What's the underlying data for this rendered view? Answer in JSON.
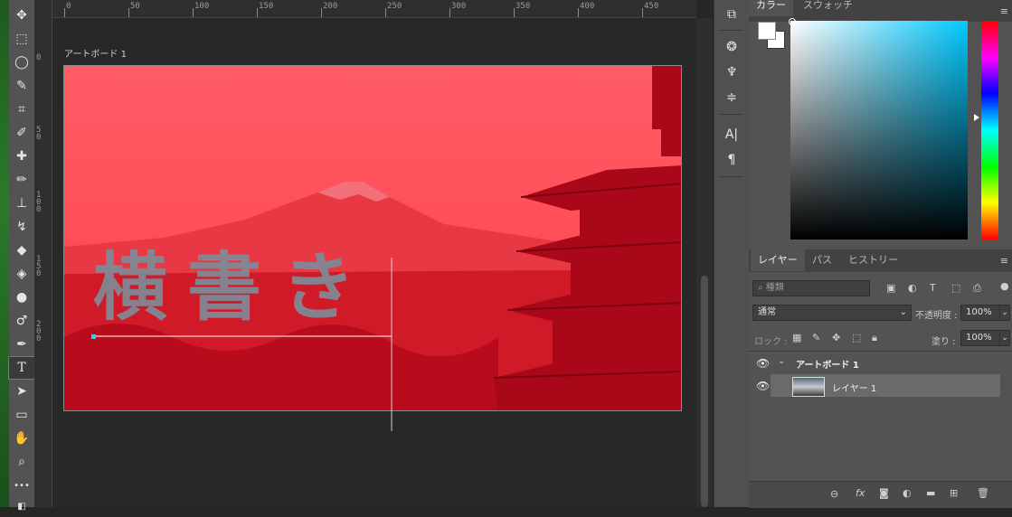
{
  "ruler": {
    "h_labels": [
      "0",
      "50",
      "100",
      "150",
      "200",
      "250",
      "300",
      "350",
      "400",
      "450"
    ],
    "v_labels": [
      "0",
      "50",
      "100",
      "150",
      "200"
    ]
  },
  "tools": [
    {
      "name": "move-tool-icon",
      "glyph": "✥"
    },
    {
      "name": "marquee-tool-icon",
      "glyph": "⬚"
    },
    {
      "name": "lasso-tool-icon",
      "glyph": "◯"
    },
    {
      "name": "quick-select-tool-icon",
      "glyph": "✎"
    },
    {
      "name": "crop-tool-icon",
      "glyph": "⌗"
    },
    {
      "name": "eyedropper-tool-icon",
      "glyph": "✐"
    },
    {
      "name": "healing-brush-tool-icon",
      "glyph": "✚"
    },
    {
      "name": "brush-tool-icon",
      "glyph": "✏"
    },
    {
      "name": "stamp-tool-icon",
      "glyph": "⊥"
    },
    {
      "name": "history-brush-tool-icon",
      "glyph": "↯"
    },
    {
      "name": "eraser-tool-icon",
      "glyph": "◆"
    },
    {
      "name": "paint-bucket-tool-icon",
      "glyph": "◈"
    },
    {
      "name": "blur-tool-icon",
      "glyph": "●"
    },
    {
      "name": "dodge-tool-icon",
      "glyph": "♂"
    },
    {
      "name": "pen-tool-icon",
      "glyph": "✒"
    },
    {
      "name": "type-tool-icon",
      "glyph": "T"
    },
    {
      "name": "path-select-tool-icon",
      "glyph": "➤"
    },
    {
      "name": "rectangle-tool-icon",
      "glyph": "▭"
    },
    {
      "name": "hand-tool-icon",
      "glyph": "✋"
    },
    {
      "name": "zoom-tool-icon",
      "glyph": "⌕"
    },
    {
      "name": "more-tools-icon",
      "glyph": "•••"
    }
  ],
  "mini_panel": [
    {
      "name": "libraries-icon",
      "glyph": "⧉"
    },
    {
      "name": "channels-icon",
      "glyph": "❂"
    },
    {
      "name": "brush-settings-icon",
      "glyph": "♆"
    },
    {
      "name": "adjustments-icon",
      "glyph": "≑"
    },
    {
      "name": "character-icon",
      "glyph": "A|"
    },
    {
      "name": "paragraph-icon",
      "glyph": "¶"
    }
  ],
  "canvas": {
    "artboard_label": "アートボード 1",
    "headline": "横書き"
  },
  "color_panel": {
    "tabs": [
      "カラー",
      "スウォッチ"
    ],
    "hue_color": "#00c8ff"
  },
  "layers_panel": {
    "tabs": [
      "レイヤー",
      "パス",
      "ヒストリー"
    ],
    "search_placeholder": "種類",
    "blend_mode": "通常",
    "opacity_label": "不透明度 :",
    "opacity_value": "100%",
    "lock_label": "ロック :",
    "fill_label": "塗り :",
    "fill_value": "100%",
    "layers": [
      {
        "name": "アートボード 1",
        "type": "artboard"
      },
      {
        "name": "レイヤー 1",
        "type": "image"
      }
    ]
  },
  "colors": {
    "overlay_red": "#e0101c",
    "ui_panel": "#535353"
  }
}
